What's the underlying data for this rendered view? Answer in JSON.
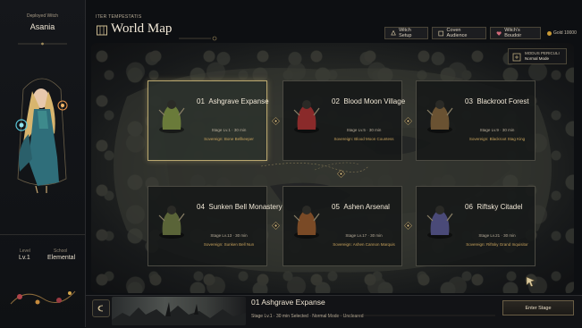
{
  "left_panel": {
    "deployed_label": "Deployed Witch",
    "witch_name": "Asania",
    "level_label": "Level",
    "level_value": "Lv.1",
    "school_label": "School",
    "school_value": "Elemental"
  },
  "header": {
    "subtitle": "ITER TEMPESTATIS",
    "title": "World Map",
    "buttons": [
      {
        "label": "Witch Setup",
        "icon": "witch-setup-icon"
      },
      {
        "label": "Coven Audience",
        "icon": "coven-icon"
      },
      {
        "label": "Witch's Boudoir",
        "icon": "heart-icon"
      }
    ],
    "gold": "Gold 10000"
  },
  "mode_panel": {
    "label": "MODUS PERICULI",
    "value": "Normal Mode"
  },
  "stages": [
    {
      "num": "01",
      "name": "Ashgrave Expanse",
      "meta": "Stage Lv.1 · 30 min",
      "sovereign": "Sovereign: Bone Bellkeeper",
      "selected": true,
      "accent": "#6a7b3a"
    },
    {
      "num": "02",
      "name": "Blood Moon Village",
      "meta": "Stage Lv.5 · 30 min",
      "sovereign": "Sovereign: Blood Moon Countess",
      "selected": false,
      "accent": "#8a2a2a"
    },
    {
      "num": "03",
      "name": "Blackroot Forest",
      "meta": "Stage Lv.9 · 30 min",
      "sovereign": "Sovereign: Blackroot Stag King",
      "selected": false,
      "accent": "#6a5232"
    },
    {
      "num": "04",
      "name": "Sunken Bell Monastery",
      "meta": "Stage Lv.13 · 30 min",
      "sovereign": "Sovereign: Sunken Bell Nun",
      "selected": false,
      "accent": "#5a6438"
    },
    {
      "num": "05",
      "name": "Ashen Arsenal",
      "meta": "Stage Lv.17 · 30 min",
      "sovereign": "Sovereign: Ashen Cannon Marquis",
      "selected": false,
      "accent": "#7a4a26"
    },
    {
      "num": "06",
      "name": "Riftsky Citadel",
      "meta": "Stage Lv.21 · 30 min",
      "sovereign": "Sovereign: Riftsky Grand Inquisitor",
      "selected": false,
      "accent": "#4a4a78"
    }
  ],
  "bottom_bar": {
    "selected_name": "01  Ashgrave Expanse",
    "selected_meta": "Stage Lv.1 · 30 min    Selected · Normal Mode · Uncleared",
    "enter_label": "Enter Stage"
  }
}
